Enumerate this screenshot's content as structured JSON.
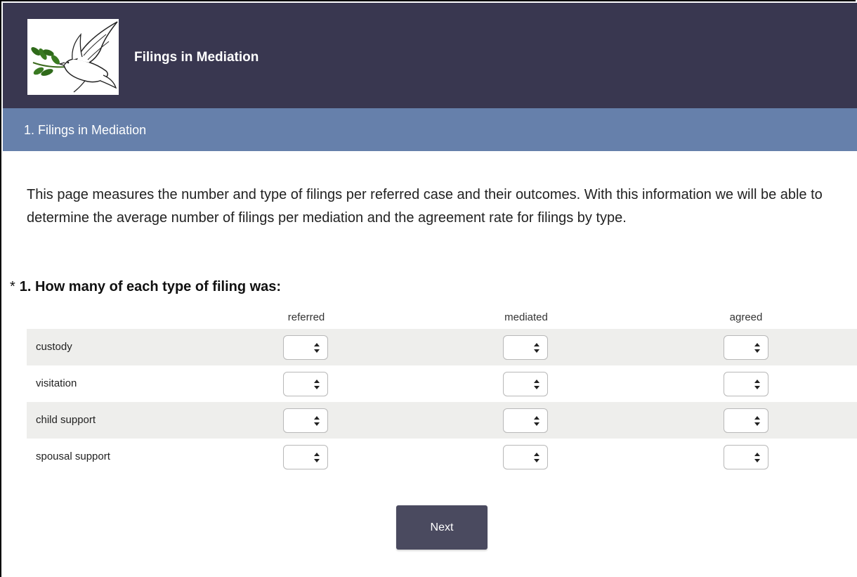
{
  "header": {
    "title": "Filings in Mediation"
  },
  "page_bar": {
    "title": "1. Filings in Mediation"
  },
  "intro": "This page measures the number and type of filings per referred case and their outcomes. With this information we will be able to determine the average number of filings per mediation and the agreement rate for filings by type.",
  "question": {
    "required_marker": "*",
    "text": "1. How many of each type of filing was:",
    "columns": [
      "referred",
      "mediated",
      "agreed"
    ],
    "rows": [
      {
        "label": "custody"
      },
      {
        "label": "visitation"
      },
      {
        "label": "child support"
      },
      {
        "label": "spousal support"
      }
    ]
  },
  "buttons": {
    "next": "Next"
  },
  "colors": {
    "header_bg": "#393750",
    "page_bar_bg": "#6680ab",
    "button_bg": "#4a4a5f"
  }
}
